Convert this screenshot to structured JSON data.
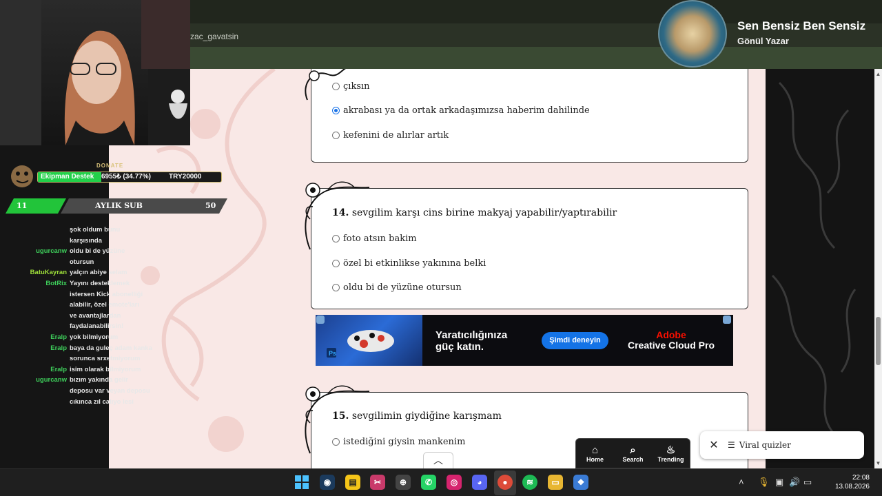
{
  "browser": {
    "url_fragment": "zac_gavatsin"
  },
  "quiz": {
    "prev_question": {
      "options": [
        {
          "label": "çıksın",
          "selected": false
        },
        {
          "label": "akrabası ya da ortak arkadaşımızsa haberim dahilinde",
          "selected": true
        },
        {
          "label": "kefenini de alırlar artık",
          "selected": false
        }
      ]
    },
    "q14": {
      "number": "14.",
      "text": "sevgilim karşı cins birine makyaj yapabilir/yaptırabilir",
      "options": [
        {
          "label": "foto atsın bakim"
        },
        {
          "label": "özel bi etkinlikse yakınına belki"
        },
        {
          "label": "oldu bi de yüzüne otursun"
        }
      ]
    },
    "q15": {
      "number": "15.",
      "text": "sevgilimin giydiğine karışmam",
      "options": [
        {
          "label": "istediğini giysin mankenim"
        }
      ]
    }
  },
  "ad": {
    "headline_1": "Yaratıcılığınıza",
    "headline_2": "güç katın.",
    "cta": "Şimdi deneyin",
    "brand_1": "Adobe",
    "brand_2": "Creative Cloud Pro"
  },
  "bottom_nav": {
    "home": "Home",
    "search": "Search",
    "trending": "Trending"
  },
  "viral_bar": {
    "close": "✕",
    "label": "Viral quizler"
  },
  "stream": {
    "donate": {
      "title": "DONATE",
      "label": "Ekipman Destek",
      "progress_text": "6955₺ (34.77%)",
      "goal": "TRY20000",
      "progress": 0.3477
    },
    "sub_goal": {
      "current": "11",
      "label": "AYLIK SUB",
      "target": "50"
    },
    "chat": [
      {
        "user": "",
        "msg": "şok oldum bunu",
        "color": "#ffffff"
      },
      {
        "user": "",
        "msg": "karşısında",
        "color": "#ffffff"
      },
      {
        "user": "ugurcanw",
        "msg": "oldu bi de yüzüne",
        "color": "#3ecf5b"
      },
      {
        "user": "",
        "msg": "otursun",
        "color": "#ffffff"
      },
      {
        "user": "BatuKayran",
        "msg": "yalçın abiye selam",
        "color": "#9fe03a"
      },
      {
        "user": "BotRix",
        "msg": "Yayını desteklemek",
        "color": "#3ecf5b"
      },
      {
        "user": "",
        "msg": "istersen Kick abonelliği",
        "color": "#ffffff"
      },
      {
        "user": "",
        "msg": "alabilir, özel emote'ları",
        "color": "#ffffff"
      },
      {
        "user": "",
        "msg": "ve avantajlardan",
        "color": "#ffffff"
      },
      {
        "user": "",
        "msg": "faydalanabilirsin!",
        "color": "#ffffff"
      },
      {
        "user": "Eralp",
        "msg": "yok bilmiyorum",
        "color": "#3ecf5b"
      },
      {
        "user": "Eralp",
        "msg": "baya da guleç adam kanka",
        "color": "#3ecf5b"
      },
      {
        "user": "",
        "msg": "sorunca srxetmiyorum",
        "color": "#ffffff"
      },
      {
        "user": "Eralp",
        "msg": "isim olarak bilmiyorum",
        "color": "#3ecf5b"
      },
      {
        "user": "ugurcanw",
        "msg": "bızım yakında gelir",
        "color": "#3ecf5b"
      },
      {
        "user": "",
        "msg": "deposu var veyan deposu",
        "color": "#ffffff"
      },
      {
        "user": "",
        "msg": "cıkınca zıl calıyo lesi",
        "color": "#ffffff"
      }
    ]
  },
  "now_playing": {
    "title": "Sen Bensiz Ben Sensiz",
    "artist": "Gönül Yazar"
  },
  "taskbar": {
    "time": "22:08",
    "date": "13.08.2026"
  }
}
